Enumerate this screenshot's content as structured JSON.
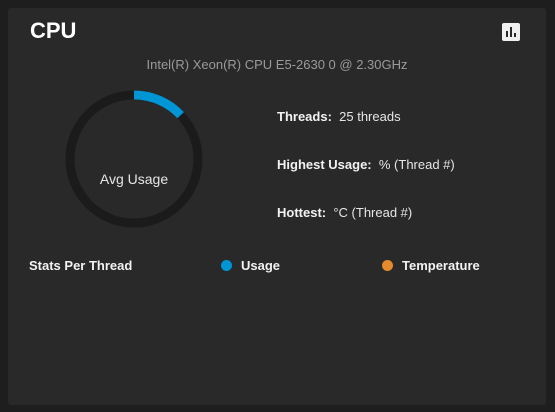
{
  "card": {
    "title": "CPU",
    "chart_button_icon": "bar-chart-icon"
  },
  "cpu": {
    "model": "Intel(R) Xeon(R) CPU E5-2630 0 @ 2.30GHz"
  },
  "gauge": {
    "label": "Avg Usage",
    "value_fraction": 0.13,
    "track_color": "#1b1b1b",
    "fill_color": "#0095d5"
  },
  "stats": {
    "threads_key": "Threads:",
    "threads_value": "25 threads",
    "highest_key": "Highest Usage:",
    "highest_value": "%  (Thread #)",
    "hottest_key": "Hottest:",
    "hottest_value": "°C  (Thread #)"
  },
  "per_thread": {
    "title": "Stats Per Thread",
    "legend": [
      {
        "label": "Usage",
        "color": "#0095d5"
      },
      {
        "label": "Temperature",
        "color": "#e68a2e"
      }
    ]
  }
}
